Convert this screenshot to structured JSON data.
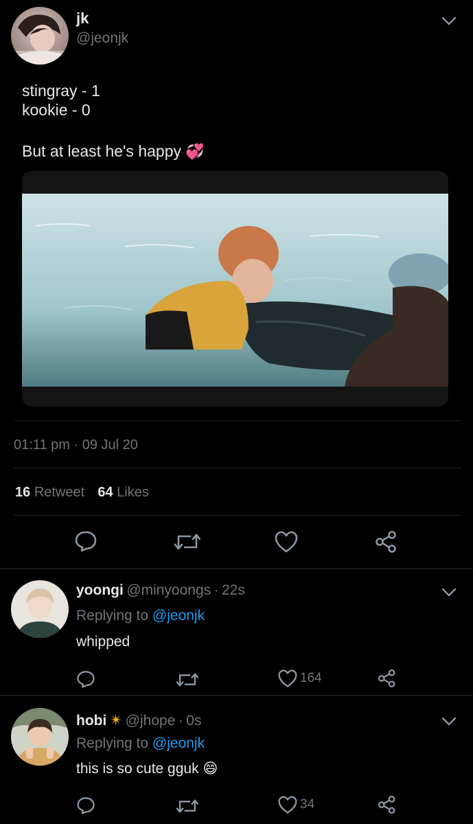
{
  "tweet": {
    "author_name": "jk",
    "author_handle": "@jeonjk",
    "text_line1": "stingray - 1",
    "text_line2": "kookie - 0",
    "text_line3": "But at least he's happy",
    "emoji": "💞",
    "time": "01:11 pm",
    "separator": "·",
    "date": "09 Jul 20",
    "retweet_count": "16",
    "retweet_label": "Retweet",
    "like_count": "64",
    "like_label": "Likes"
  },
  "replies": [
    {
      "name": "yoongi",
      "handle": "@minyoongs",
      "separator": "·",
      "time": "22s",
      "replying_label": "Replying to",
      "replying_handle": "@jeonjk",
      "text": "whipped",
      "like_count": "164"
    },
    {
      "name": "hobi",
      "badge": "✴",
      "handle": "@jhope",
      "separator": "·",
      "time": "0s",
      "replying_label": "Replying to",
      "replying_handle": "@jeonjk",
      "text": "this is so cute gguk",
      "emoji": "😄",
      "like_count": "34"
    }
  ],
  "icons": {
    "reply": "reply-icon",
    "retweet": "retweet-icon",
    "like": "heart-icon",
    "share": "share-icon",
    "more": "chevron-down-icon"
  },
  "colors": {
    "background": "#000000",
    "text": "#e7e9ea",
    "muted": "#6e767d",
    "link": "#1d9bf0",
    "icon": "#8b98a5"
  }
}
